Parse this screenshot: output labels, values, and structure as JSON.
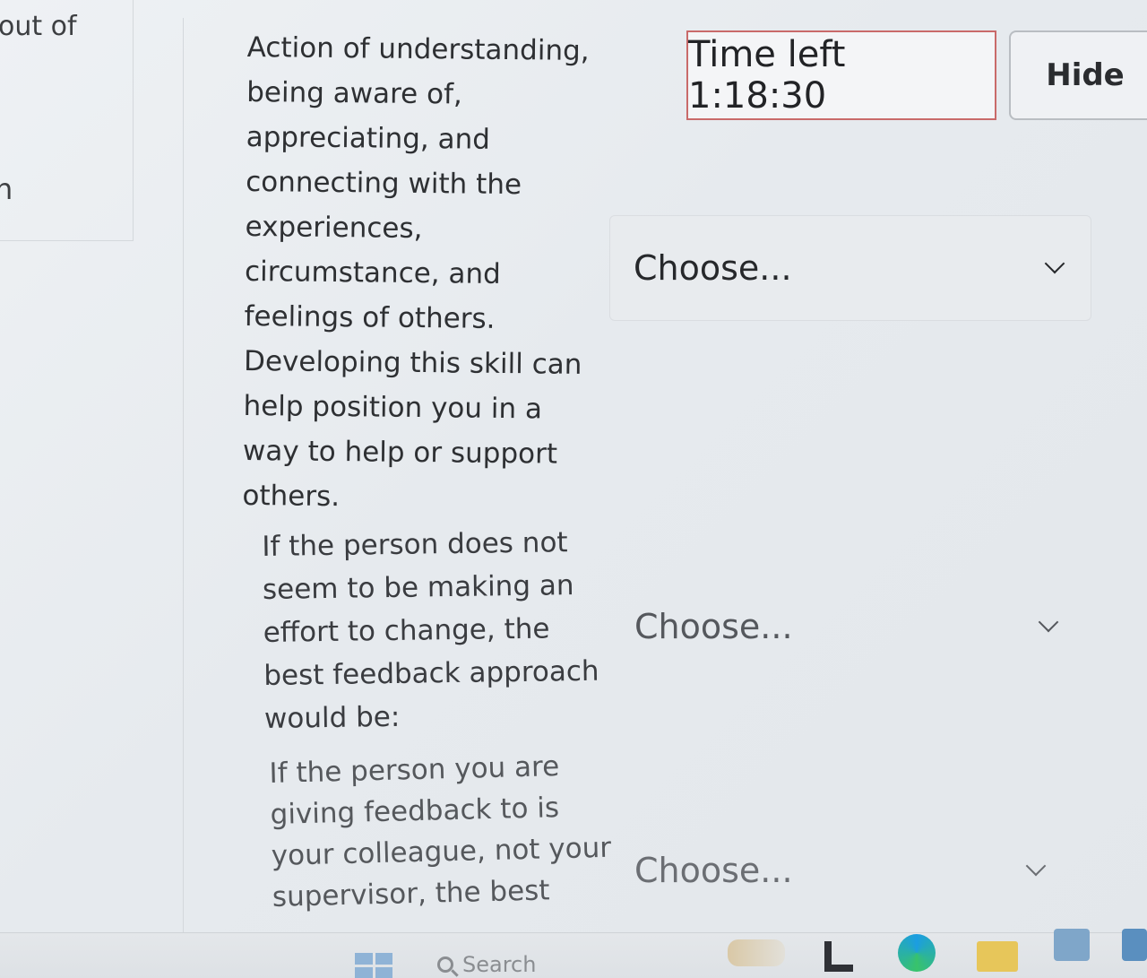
{
  "left_panel": {
    "text": "out of",
    "fragment": "n"
  },
  "questions": [
    {
      "text": "Action of understanding, being aware of, appreciating, and connecting with the experiences, circumstance, and feelings of others. Developing this skill can help position you in a way to help or support others.",
      "selected": "Choose..."
    },
    {
      "text": "If the person does not seem to be making an effort to change, the best feedback approach would be:",
      "selected": "Choose..."
    },
    {
      "text": "If the person you are giving feedback to is your colleague, not your supervisor, the best",
      "selected": "Choose..."
    }
  ],
  "timer": {
    "label": "Time left 1:18:30"
  },
  "hide_button": {
    "label": "Hide"
  },
  "taskbar": {
    "search_label": "Search"
  }
}
